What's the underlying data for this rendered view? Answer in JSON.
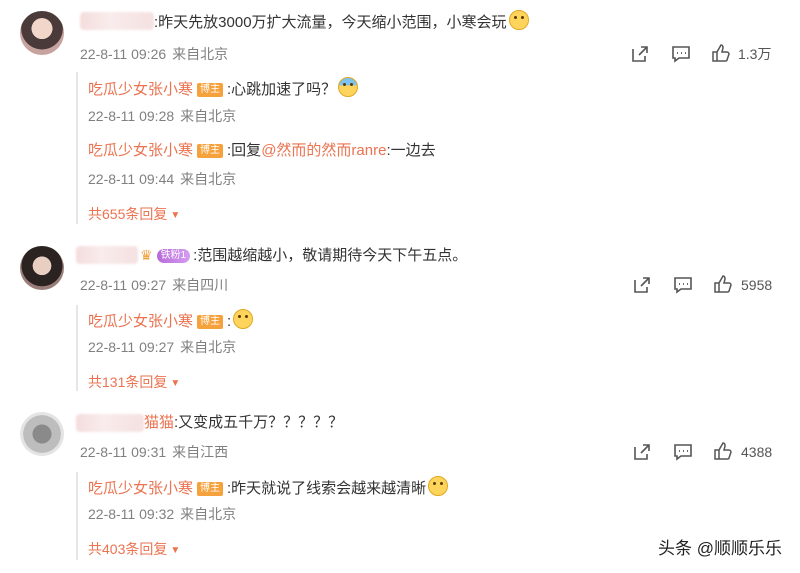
{
  "comments": [
    {
      "text": ":昨天先放3000万扩大流量，今天缩小范围，小寒会玩",
      "meta_time": "22-8-11 09:26",
      "meta_src": "来自北京",
      "like_count": "1.3万",
      "replies": [
        {
          "name": "吃瓜少女张小寒",
          "badge": "博主",
          "text": ":心跳加速了吗？",
          "time": "22-8-11 09:28",
          "src": "来自北京"
        },
        {
          "name": "吃瓜少女张小寒",
          "badge": "博主",
          "text_prefix": ":回复",
          "mention": "@然而的然而ranre",
          "text": ":一边去",
          "time": "22-8-11 09:44",
          "src": "来自北京"
        }
      ],
      "more": "共655条回复"
    },
    {
      "fan_badge": "铁粉1",
      "text": ":范围越缩越小，敬请期待今天下午五点。",
      "meta_time": "22-8-11 09:27",
      "meta_src": "来自四川",
      "like_count": "5958",
      "replies": [
        {
          "name": "吃瓜少女张小寒",
          "badge": "博主",
          "text": ":",
          "time": "22-8-11 09:27",
          "src": "来自北京"
        }
      ],
      "more": "共131条回复"
    },
    {
      "name_visible": "猫猫",
      "text": ":又变成五千万？？？？？",
      "meta_time": "22-8-11 09:31",
      "meta_src": "来自江西",
      "like_count": "4388",
      "replies": [
        {
          "name": "吃瓜少女张小寒",
          "badge": "博主",
          "text": ":昨天就说了线索会越来越清晰",
          "time": "22-8-11 09:32",
          "src": "来自北京"
        }
      ],
      "more": "共403条回复"
    }
  ],
  "watermark": "头条 @顺顺乐乐",
  "icons": [
    "share-icon",
    "comment-icon",
    "like-icon",
    "caret-down-icon"
  ],
  "colors": {
    "accent": "#eb7350",
    "badge": "#f6a23c",
    "meta": "#808080"
  }
}
